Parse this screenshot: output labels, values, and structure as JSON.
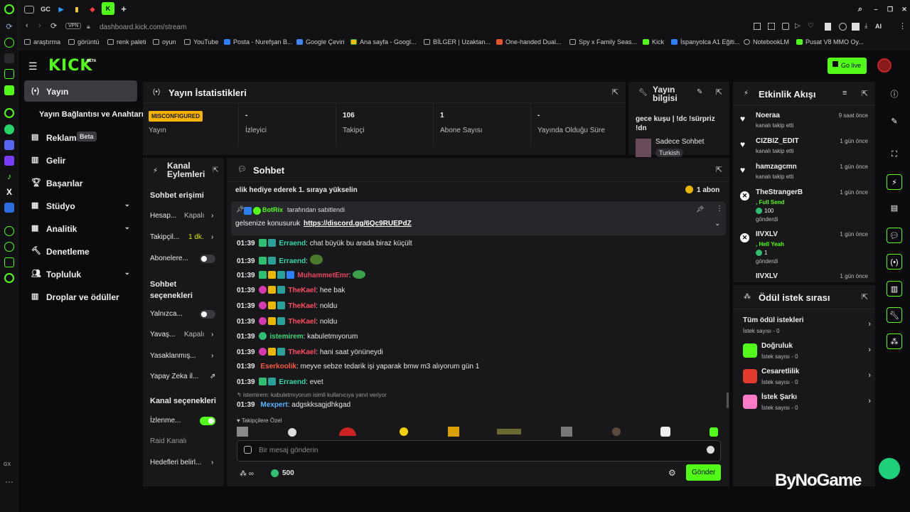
{
  "browser": {
    "url": "dashboard.kick.com/stream",
    "vpn": "VPN",
    "tab_labels": [
      "GC"
    ],
    "ai_label": "AI",
    "gx_label": "GX",
    "bookmarks": [
      "araştırma",
      "görüntü",
      "renk paleti",
      "oyun",
      "YouTube",
      "Posta - Nurefşan B...",
      "Google Çeviri",
      "Ana sayfa - Googl...",
      "BİLGER | Uzaktan...",
      "One-handed Dual...",
      "Spy x Family Seas...",
      "Kick",
      "İspanyolca A1 Eğiti...",
      "NotebookLM",
      "Pusat V8 MMO Oy..."
    ]
  },
  "header": {
    "logo": "KICK",
    "logo_beta": "BETA",
    "go_live": "Go live"
  },
  "sidebar": {
    "items": [
      {
        "label": "Yayın",
        "icon": "stream-icon"
      },
      {
        "label": "Yayın Bağlantısı ve Anahtarı",
        "icon": ""
      },
      {
        "label": "Reklam",
        "icon": "ad-icon",
        "badge": "Beta"
      },
      {
        "label": "Gelir",
        "icon": "revenue-icon"
      },
      {
        "label": "Başarılar",
        "icon": "trophy-icon"
      },
      {
        "label": "Stüdyo",
        "icon": "studio-icon"
      },
      {
        "label": "Analitik",
        "icon": "analytics-icon"
      },
      {
        "label": "Denetleme",
        "icon": "moderation-icon"
      },
      {
        "label": "Topluluk",
        "icon": "community-icon"
      },
      {
        "label": "Droplar ve ödüller",
        "icon": "drops-icon"
      }
    ]
  },
  "stats": {
    "title": "Yayın İstatistikleri",
    "cells": [
      {
        "value": "MISCONFIGURED",
        "label": "Yayın"
      },
      {
        "value": "-",
        "label": "İzleyici"
      },
      {
        "value": "106",
        "label": "Takipçi"
      },
      {
        "value": "1",
        "label": "Abone Sayısı"
      },
      {
        "value": "-",
        "label": "Yayında Olduğu Süre"
      }
    ]
  },
  "stream_info": {
    "title": "Yayın bilgisi",
    "stream_title": "gece kuşu | !dc !sürpriz !dn",
    "category": "Sadece Sohbet",
    "language": "Turkish"
  },
  "channel_actions": {
    "title": "Kanal Eylemleri",
    "chat_access": "Sohbet erişimi",
    "rows": [
      {
        "label": "Hesap...",
        "value": "Kapalı"
      },
      {
        "label": "Takipçil...",
        "value": "1 dk."
      },
      {
        "label": "Abonelere...",
        "value": ""
      }
    ],
    "chat_options": "Sohbet seçenekleri",
    "rows2": [
      {
        "label": "Yalnızca...",
        "value": ""
      },
      {
        "label": "Yavaş...",
        "value": "Kapalı"
      },
      {
        "label": "Yasaklanmış...",
        "value": ""
      },
      {
        "label": "Yapay Zeka il...",
        "value": ""
      }
    ],
    "channel_options": "Kanal seçenekleri",
    "rows3": [
      {
        "label": "İzlenme...",
        "value": ""
      },
      {
        "label": "Raid Kanalı",
        "value": ""
      },
      {
        "label": "Hedefleri belirl...",
        "value": ""
      }
    ]
  },
  "chat": {
    "title": "Sohbet",
    "top_banner": "elik hediye ederek 1. sıraya yükselin",
    "top_banner_right": "1 abon",
    "pinned_by": "BotRix",
    "pinned_suffix": "tarafından sabitlendi",
    "pinned_text": "gelsenize konusuruk",
    "pinned_link": "https://discord.gg/6Qc9RUEPdZ",
    "messages": [
      {
        "time": "01:39",
        "user": "Erraend",
        "color": "#33d6a6",
        "text": "chat büyük bu arada biraz küçült"
      },
      {
        "time": "01:39",
        "user": "Erraend",
        "color": "#33d6a6",
        "text": ""
      },
      {
        "time": "01:39",
        "user": "MuhammetEmr",
        "color": "#e94560",
        "text": ""
      },
      {
        "time": "01:39",
        "user": "TheKael",
        "color": "#ff4d5e",
        "text": "hee bak"
      },
      {
        "time": "01:39",
        "user": "TheKael",
        "color": "#ff4d5e",
        "text": "noldu"
      },
      {
        "time": "01:39",
        "user": "TheKael",
        "color": "#ff4d5e",
        "text": "noldu"
      },
      {
        "time": "01:39",
        "user": "istemirem",
        "color": "#37d67a",
        "text": "kabuletmıyorum"
      },
      {
        "time": "01:39",
        "user": "TheKael",
        "color": "#ff4d5e",
        "text": "hani saat yönüneydi"
      },
      {
        "time": "01:39",
        "user": "Eserkoolik",
        "color": "#ff5a3c",
        "text": "meyve sebze tedarik işi yaparak bmw m3 alıyorum gün 1"
      },
      {
        "time": "01:39",
        "user": "Erraend",
        "color": "#33d6a6",
        "text": "evet"
      }
    ],
    "reply_note": "istemirem: kabuletmıyorum isimli kullanıcıya yanıt veriyor",
    "last_message": {
      "time": "01:39",
      "user": "Mexpert",
      "color": "#58b4ff",
      "text": "adgskksagjdhkgad"
    },
    "followers_only": "Takipçilere Özel",
    "input_placeholder": "Bir mesaj gönderin",
    "points": "500",
    "send": "Gönder"
  },
  "activity": {
    "title": "Etkinlik Akışı",
    "items": [
      {
        "name": "Noeraa",
        "sub": "kanalı takip etti",
        "time": "9 saat önce",
        "icon": "heart-icon"
      },
      {
        "name": "CIZBIZ_EDIT",
        "sub": "kanalı takip etti",
        "time": "1 gün önce",
        "icon": "heart-icon"
      },
      {
        "name": "hamzagcmn",
        "sub": "kanalı takip etti",
        "time": "1 gün önce",
        "icon": "heart-icon"
      },
      {
        "name": "TheStrangerB",
        "sub": ", Full Send",
        "amount": "100",
        "sent": "gönderdi",
        "time": "1 gün önce",
        "icon": "kick-icon"
      },
      {
        "name": "IIVXLV",
        "sub": ", Hell Yeah",
        "amount": "1",
        "sent": "gönderdi",
        "time": "1 gün önce",
        "icon": "kick-icon"
      },
      {
        "name": "IIVXLV",
        "sub": "",
        "time": "1 gün önce",
        "icon": "kick-icon"
      }
    ]
  },
  "rewards": {
    "title": "Ödül istek sırası",
    "all": "Tüm ödül istekleri",
    "all_sub": "İstek sayısı - 0",
    "items": [
      {
        "name": "Doğruluk",
        "sub": "İstek sayısı - 0",
        "color": "#53fc18"
      },
      {
        "name": "Cesaretlilik",
        "sub": "İstek sayısı - 0",
        "color": "#e23b2e"
      },
      {
        "name": "İstek Şarkı",
        "sub": "İstek sayısı - 0",
        "color": "#ff7ac6"
      }
    ]
  },
  "watermark": "ByNoGame",
  "colors": {
    "accent": "#53fc18",
    "panel": "#18181b",
    "bg": "#0b0b0d"
  }
}
